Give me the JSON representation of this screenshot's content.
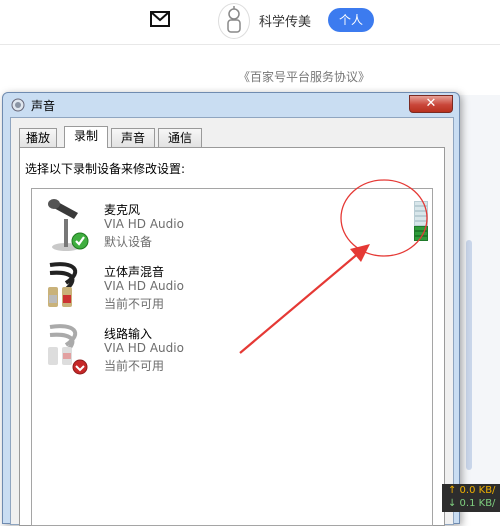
{
  "header": {
    "username": "科学传美",
    "personal_button": "个人"
  },
  "background_link": "《百家号平台服务协议》",
  "dialog": {
    "title": "声音",
    "close_label": "✕",
    "tabs": [
      {
        "label": "播放"
      },
      {
        "label": "录制",
        "active": true
      },
      {
        "label": "声音"
      },
      {
        "label": "通信"
      }
    ],
    "instruction": "选择以下录制设备来修改设置:",
    "devices": [
      {
        "name": "麦克风",
        "driver": "VIA HD Audio",
        "status": "默认设备",
        "icon": "microphone-icon",
        "badge": "check-badge-icon"
      },
      {
        "name": "立体声混音",
        "driver": "VIA HD Audio",
        "status": "当前不可用",
        "icon": "stereo-cable-icon"
      },
      {
        "name": "线路输入",
        "driver": "VIA HD Audio",
        "status": "当前不可用",
        "icon": "line-in-cable-icon",
        "badge": "disconnected-badge-icon"
      }
    ]
  },
  "tray": {
    "up": "↑ 0.0 KB/",
    "down": "↓ 0.1 KB/"
  },
  "colors": {
    "accent": "#3c7bef",
    "annotation": "#e53935",
    "level_on": "#2f9c3a"
  }
}
